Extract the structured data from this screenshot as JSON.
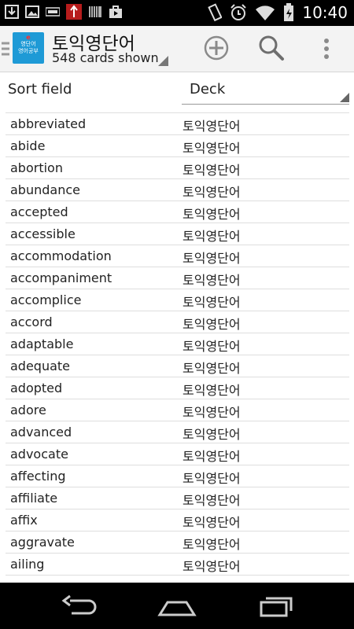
{
  "status_bar": {
    "time": "10:40",
    "left_icons": [
      "download-icon",
      "image-icon",
      "keyboard-icon",
      "rss-icon",
      "barcode-icon",
      "store-icon"
    ],
    "right_icons": [
      "vibrate-icon",
      "alarm-icon",
      "wifi-icon",
      "battery-icon"
    ]
  },
  "action_bar": {
    "logo_text_top": "e",
    "logo_line1": "영단어",
    "logo_line2": "영어공부",
    "title": "토익영단어",
    "subtitle": "548 cards shown"
  },
  "table": {
    "headers": {
      "sort_field": "Sort field",
      "deck": "Deck"
    },
    "rows": [
      {
        "word": "abbreviated",
        "deck": "토익영단어"
      },
      {
        "word": "abide",
        "deck": "토익영단어"
      },
      {
        "word": "abortion",
        "deck": "토익영단어"
      },
      {
        "word": "abundance",
        "deck": "토익영단어"
      },
      {
        "word": "accepted",
        "deck": "토익영단어"
      },
      {
        "word": "accessible",
        "deck": "토익영단어"
      },
      {
        "word": "accommodation",
        "deck": "토익영단어"
      },
      {
        "word": "accompaniment",
        "deck": "토익영단어"
      },
      {
        "word": "accomplice",
        "deck": "토익영단어"
      },
      {
        "word": "accord",
        "deck": "토익영단어"
      },
      {
        "word": "adaptable",
        "deck": "토익영단어"
      },
      {
        "word": "adequate",
        "deck": "토익영단어"
      },
      {
        "word": "adopted",
        "deck": "토익영단어"
      },
      {
        "word": "adore",
        "deck": "토익영단어"
      },
      {
        "word": "advanced",
        "deck": "토익영단어"
      },
      {
        "word": "advocate",
        "deck": "토익영단어"
      },
      {
        "word": "affecting",
        "deck": "토익영단어"
      },
      {
        "word": "affiliate",
        "deck": "토익영단어"
      },
      {
        "word": "affix",
        "deck": "토익영단어"
      },
      {
        "word": "aggravate",
        "deck": "토익영단어"
      },
      {
        "word": "ailing",
        "deck": "토익영단어"
      }
    ]
  },
  "nav_bar": {
    "icons": [
      "back-icon",
      "home-icon",
      "recents-icon"
    ]
  },
  "colors": {
    "logo_bg": "#1e9ad6",
    "action_bar_bg": "#f3f3f3"
  }
}
